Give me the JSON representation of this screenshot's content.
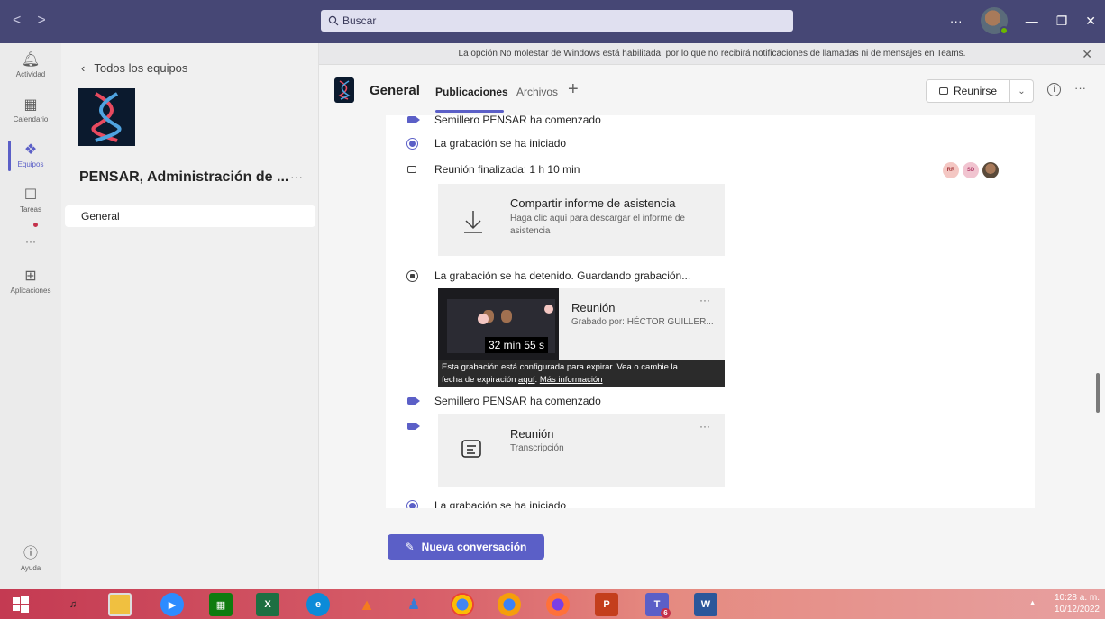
{
  "titlebar": {
    "search_placeholder": "Buscar",
    "more_label": "···"
  },
  "rail": {
    "items": [
      {
        "label": "Actividad",
        "icon": "bell-icon"
      },
      {
        "label": "Calendario",
        "icon": "calendar-icon"
      },
      {
        "label": "Equipos",
        "icon": "teams-icon"
      },
      {
        "label": "Tareas",
        "icon": "tasks-icon"
      },
      {
        "label": "···",
        "icon": "more-icon"
      },
      {
        "label": "Aplicaciones",
        "icon": "apps-icon"
      }
    ],
    "help_label": "Ayuda"
  },
  "team_panel": {
    "back_label": "Todos los equipos",
    "team_name": "PENSAR, Administración de ...",
    "more": "···",
    "channel": "General"
  },
  "banner": {
    "text": "La opción No molestar de Windows está habilitada, por lo que no recibirá notificaciones de llamadas ni de mensajes en Teams."
  },
  "channel_header": {
    "title": "General",
    "tabs": [
      "Publicaciones",
      "Archivos"
    ],
    "add_tab": "+",
    "meet_label": "Reunirse",
    "more": "···"
  },
  "feed": {
    "events": [
      "Semillero PENSAR ha comenzado",
      "La grabación se ha iniciado",
      "Reunión finalizada: 1 h 10 min",
      "La grabación se ha detenido. Guardando grabación...",
      "Semillero PENSAR ha comenzado",
      "La grabación se ha iniciado"
    ],
    "attendance_card": {
      "title": "Compartir informe de asistencia",
      "subtitle_line1": "Haga clic aquí para descargar el informe de",
      "subtitle_line2": "asistencia"
    },
    "participants": [
      "RR",
      "SD"
    ],
    "recording_card": {
      "title": "Reunión",
      "subtitle": "Grabado por: HÉCTOR GUILLER...",
      "duration": "32 min 55 s",
      "more": "···"
    },
    "tooltip": {
      "line1": "Esta grabación está configurada para expirar. Vea o cambie la",
      "line2_prefix": "fecha de expiración",
      "link1": "aquí",
      "link2": "Más información"
    },
    "transcript_card": {
      "title": "Reunión",
      "subtitle": "Transcripción",
      "more": "···"
    }
  },
  "compose": {
    "label": "Nueva conversación"
  },
  "taskbar": {
    "time": "10:28 a. m.",
    "date": "10/12/2022",
    "teams_badge": "6"
  },
  "colors": {
    "accent": "#5b5fc7",
    "titlebar": "#464775"
  }
}
